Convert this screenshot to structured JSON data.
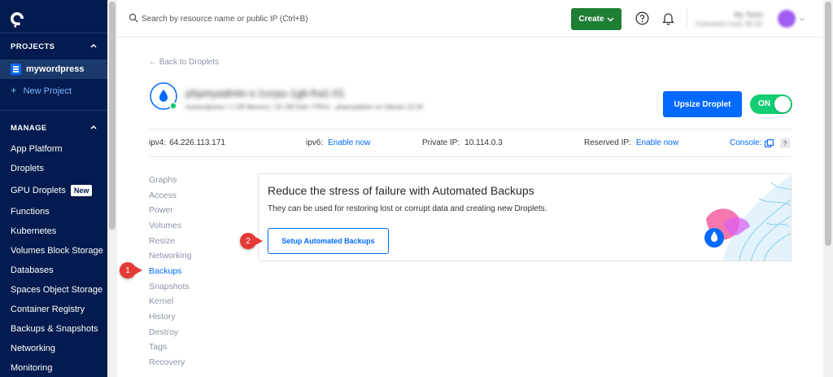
{
  "sidebar": {
    "projects_header": "PROJECTS",
    "project_name": "mywordpress",
    "new_project": "New Project",
    "manage_header": "MANAGE",
    "new_badge": "New",
    "items": [
      {
        "label": "App Platform"
      },
      {
        "label": "Droplets"
      },
      {
        "label": "GPU Droplets"
      },
      {
        "label": "Functions"
      },
      {
        "label": "Kubernetes"
      },
      {
        "label": "Volumes Block Storage"
      },
      {
        "label": "Databases"
      },
      {
        "label": "Spaces Object Storage"
      },
      {
        "label": "Container Registry"
      },
      {
        "label": "Backups & Snapshots"
      },
      {
        "label": "Networking"
      },
      {
        "label": "Monitoring"
      }
    ]
  },
  "topbar": {
    "search_placeholder": "Search by resource name or public IP (Ctrl+B)",
    "create_label": "Create",
    "account_name": "My Team",
    "account_sub": "Estimated costs: $0.00"
  },
  "droplet": {
    "back_label": "Back to Droplets",
    "name": "phpmyadmin-s-1vcpu-1gb-fra1-01",
    "meta": "mywordpress / 1 GB Memory / 25 GB Disk / FRA1 - phpmyadmin on Ubuntu 22.04",
    "resize_label": "Upsize Droplet",
    "power_label": "ON"
  },
  "ipbar": {
    "ipv4_label": "ipv4:",
    "ipv4_value": "64.226.113.171",
    "ipv6_label": "ipv6:",
    "ipv6_link": "Enable now",
    "private_label": "Private IP:",
    "private_value": "10.114.0.3",
    "reserved_label": "Reserved IP:",
    "reserved_link": "Enable now",
    "console_label": "Console:",
    "help_mark": "?"
  },
  "subnav": [
    {
      "label": "Graphs"
    },
    {
      "label": "Access"
    },
    {
      "label": "Power"
    },
    {
      "label": "Volumes"
    },
    {
      "label": "Resize"
    },
    {
      "label": "Networking"
    },
    {
      "label": "Backups"
    },
    {
      "label": "Snapshots"
    },
    {
      "label": "Kernel"
    },
    {
      "label": "History"
    },
    {
      "label": "Destroy"
    },
    {
      "label": "Tags"
    },
    {
      "label": "Recovery"
    }
  ],
  "backup_card": {
    "title": "Reduce the stress of failure with Automated Backups",
    "description": "They can be used for restoring lost or corrupt data and creating new Droplets.",
    "button_label": "Setup Automated Backups"
  },
  "callouts": {
    "first": "1",
    "second": "2"
  },
  "colors": {
    "sidebar_bg": "#031b4e",
    "primary": "#0069ff",
    "create_green": "#1e7e34",
    "toggle_green": "#15cd72",
    "callout_red": "#e53935"
  }
}
